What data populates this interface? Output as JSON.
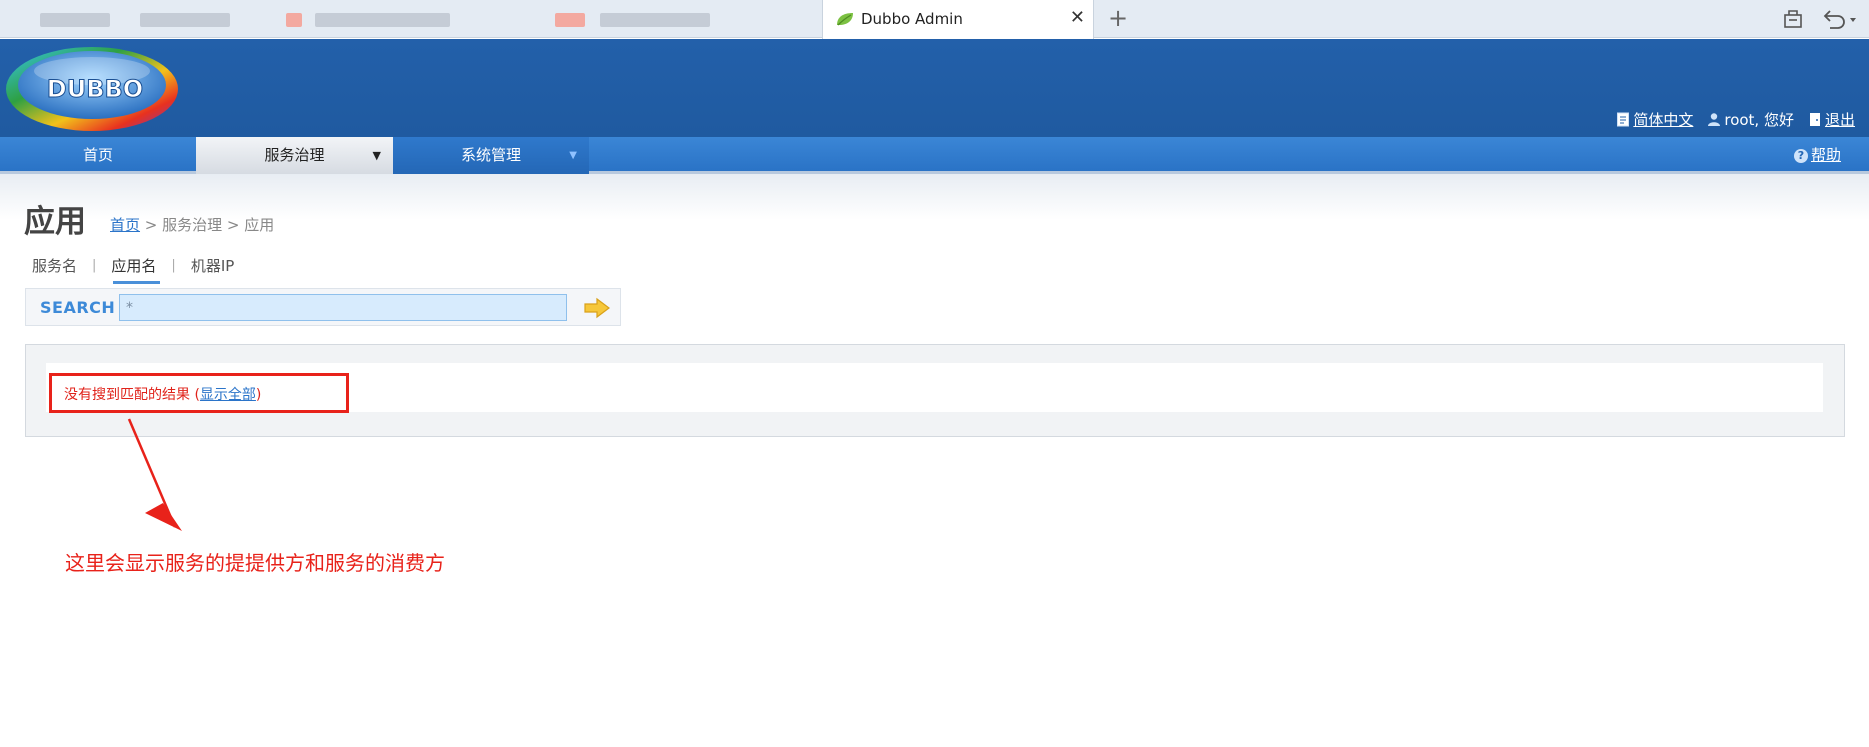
{
  "browser": {
    "tab_title": "Dubbo Admin",
    "close_glyph": "✕",
    "new_tab_glyph": "+"
  },
  "header": {
    "logo_text": "DUBBO",
    "language_link": "简体中文",
    "user_greeting": "root, 您好",
    "logout_link": "退出"
  },
  "nav": {
    "home": "首页",
    "service_governance": "服务治理",
    "system_management": "系统管理",
    "help": "帮助",
    "service_caret": "▼",
    "system_caret": "▼"
  },
  "page": {
    "title": "应用",
    "breadcrumb": {
      "home": "首页",
      "sep1": " > ",
      "level2": "服务治理",
      "sep2": " > ",
      "current": "应用"
    }
  },
  "search": {
    "tabs": [
      "服务名",
      "应用名",
      "机器IP"
    ],
    "active_tab": "应用名",
    "label": "SEARCH",
    "value": "*"
  },
  "results": {
    "message_prefix": "没有搜到匹配的结果 (",
    "show_all_link": "显示全部",
    "message_suffix": ")"
  },
  "annotation": {
    "text": "这里会显示服务的提提供方和服务的消费方"
  },
  "colors": {
    "header_blue": "#2360aa",
    "nav_blue": "#3b86d6",
    "annotation_red": "#e8221a",
    "link_blue": "#2b74c9"
  }
}
